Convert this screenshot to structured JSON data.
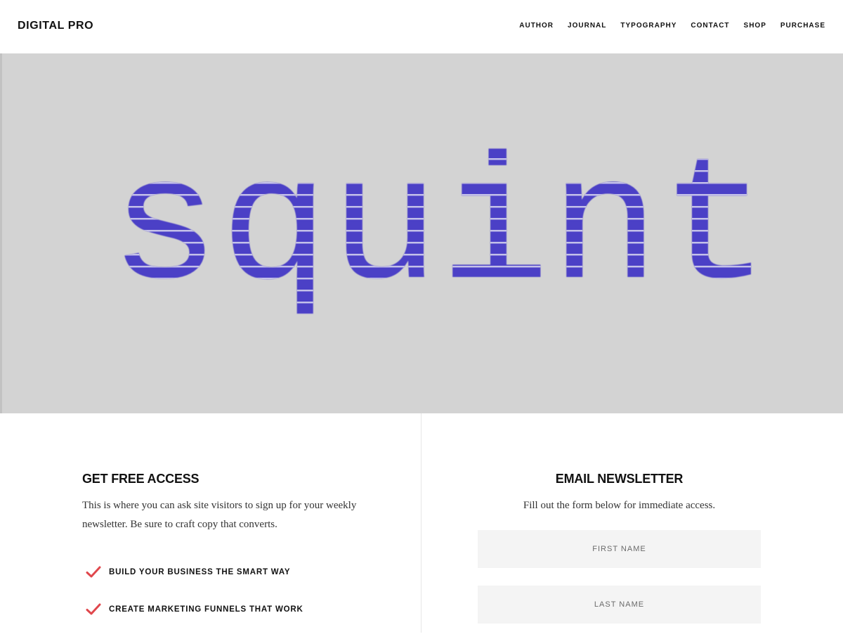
{
  "header": {
    "site_title": "DIGITAL PRO",
    "nav": [
      {
        "label": "AUTHOR"
      },
      {
        "label": "JOURNAL"
      },
      {
        "label": "TYPOGRAPHY"
      },
      {
        "label": "CONTACT"
      },
      {
        "label": "SHOP"
      },
      {
        "label": "PURCHASE"
      }
    ]
  },
  "hero": {
    "word": "squint",
    "background_color": "#d3d3d3",
    "text_color": "#4b3fc6"
  },
  "access": {
    "heading": "GET FREE ACCESS",
    "text": "This is where you can ask site visitors to sign up for your weekly newsletter. Be sure to craft copy that converts.",
    "checklist": [
      {
        "label": "BUILD YOUR BUSINESS THE SMART WAY",
        "icon": "check-icon"
      },
      {
        "label": "CREATE MARKETING FUNNELS THAT WORK",
        "icon": "check-icon"
      }
    ],
    "check_color": "#e0474c"
  },
  "newsletter": {
    "heading": "EMAIL NEWSLETTER",
    "text": "Fill out the form below for immediate access.",
    "first_name_placeholder": "FIRST NAME",
    "last_name_placeholder": "LAST NAME"
  }
}
